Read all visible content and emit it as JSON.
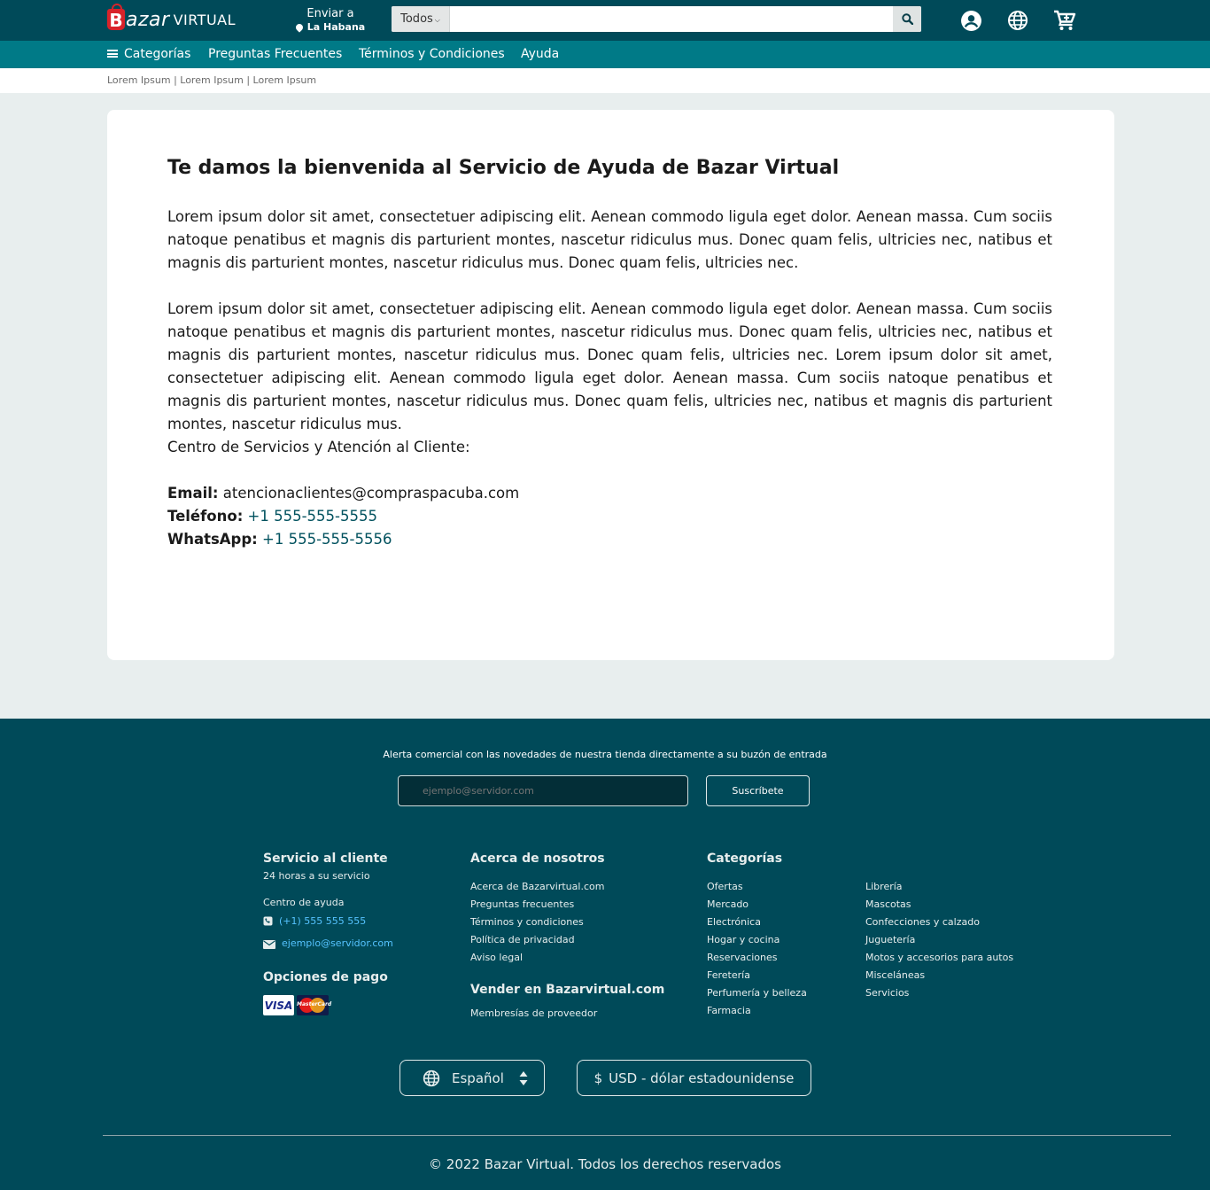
{
  "header": {
    "logo_mark": "B",
    "logo_bazar": "azar",
    "logo_virtual": "VIRTUAL",
    "ship_line1": "Enviar a",
    "ship_line2": "La Habana",
    "search_category": "Todos",
    "search_placeholder": ""
  },
  "nav": {
    "categories": "Categorías",
    "faq": "Preguntas Frecuentes",
    "terms": "Términos y Condiciones",
    "help": "Ayuda"
  },
  "breadcrumb": "Lorem Ipsum | Lorem Ipsum | Lorem Ipsum",
  "main": {
    "title": "Te damos la bienvenida al Servicio de Ayuda de Bazar Virtual",
    "paragraph1": "Lorem ipsum dolor sit amet, consectetuer adipiscing elit. Aenean commodo ligula eget dolor. Aenean massa. Cum sociis natoque penatibus et magnis dis parturient montes, nascetur ridiculus mus. Donec quam felis, ultricies nec, natibus et magnis dis parturient montes, nascetur ridiculus mus. Donec quam felis, ultricies nec.",
    "paragraph2": "Lorem ipsum dolor sit amet, consectetuer adipiscing elit. Aenean commodo ligula eget dolor. Aenean massa. Cum sociis natoque penatibus et magnis dis parturient montes, nascetur ridiculus mus. Donec quam felis, ultricies nec, natibus et magnis dis parturient montes, nascetur ridiculus mus. Donec quam felis, ultricies nec. Lorem ipsum dolor sit amet, consectetuer adipiscing elit. Aenean commodo ligula eget dolor. Aenean massa. Cum sociis natoque penatibus et magnis dis parturient montes, nascetur ridiculus mus. Donec quam felis, ultricies nec, natibus et magnis dis parturient montes, nascetur ridiculus mus.",
    "service_center": "Centro de Servicios y Atención al Cliente:",
    "email_label": "Email:",
    "email_value": "atencionaclientes@compraspacuba.com",
    "phone_label": "Teléfono:",
    "phone_value": "+1 555-555-5555",
    "whatsapp_label": "WhatsApp:",
    "whatsapp_value": "+1 555-555-5556"
  },
  "footer": {
    "alert_text": "Alerta comercial con las novedades de nuestra tienda directamente a su buzón de entrada",
    "newsletter_placeholder": "ejemplo@servidor.com",
    "subscribe_label": "Suscríbete",
    "customer_service": {
      "title": "Servicio al cliente",
      "subtitle": "24 horas a su servicio",
      "help_center": "Centro de ayuda",
      "phone": "(+1) 555 555 555",
      "email": "ejemplo@servidor.com"
    },
    "payment": {
      "title": "Opciones de pago",
      "visa": "VISA",
      "mastercard": "MasterCard"
    },
    "about": {
      "title": "Acerca de nosotros",
      "links": [
        "Acerca de Bazarvirtual.com",
        "Preguntas frecuentes",
        "Términos y condiciones",
        "Política de privacidad",
        "Aviso legal"
      ]
    },
    "sell": {
      "title": "Vender en Bazarvirtual.com",
      "links": [
        "Membresías de proveedor"
      ]
    },
    "categories": {
      "title": "Categorías",
      "col1": [
        "Ofertas",
        "Mercado",
        "Electrónica",
        "Hogar y cocina",
        "Reservaciones",
        "Feretería",
        "Perfumería y belleza",
        "Farmacia"
      ],
      "col2": [
        "Librería",
        "Mascotas",
        "Confecciones y calzado",
        "Juguetería",
        "Motos y accesorios para autos",
        "Misceláneas",
        "Servicios"
      ]
    },
    "language": "Español",
    "currency": "USD - dólar estadounidense",
    "copyright": "© 2022  Bazar Virtual. Todos los derechos reservados"
  },
  "colors": {
    "header_bg": "#004a59",
    "nav_bg": "#007a87",
    "page_bg": "#e8eeee",
    "link": "#00515e",
    "footer_link": "#55c3ff",
    "brand_red": "#d8232a"
  }
}
